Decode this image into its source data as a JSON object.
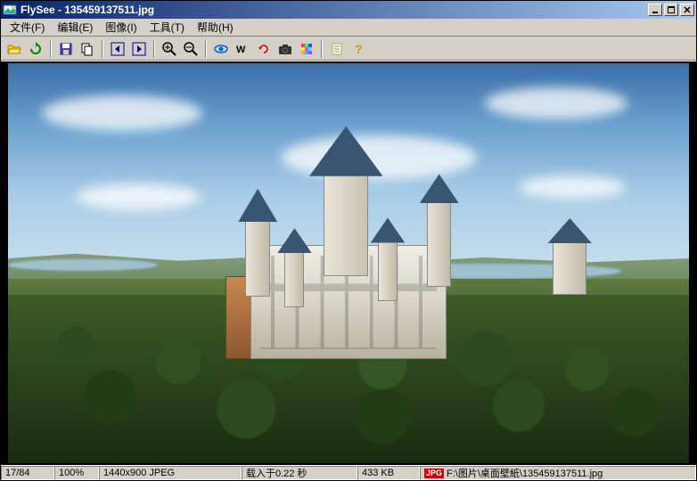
{
  "title": "FlySee - 135459137511.jpg",
  "menu": {
    "file": "文件(F)",
    "edit": "编辑(E)",
    "image": "图像(I)",
    "tools": "工具(T)",
    "help": "帮助(H)"
  },
  "status": {
    "index": "17/84",
    "zoom": "100%",
    "dimensions": "1440x900 JPEG",
    "load_time": "载入于0.22 秒",
    "file_size": "433 KB",
    "format_badge": "JPG",
    "path": "F:\\图片\\桌面壁紙\\135459137511.jpg"
  }
}
